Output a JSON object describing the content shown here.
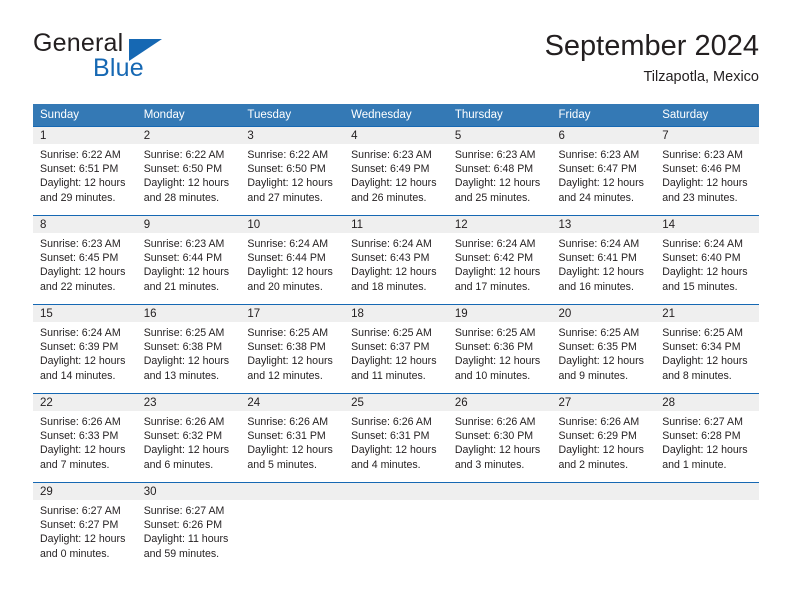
{
  "brand": {
    "name_top": "General",
    "name_bottom": "Blue",
    "triangle_icon": "triangle-icon",
    "color_dark": "#231f20",
    "color_blue": "#1668b3"
  },
  "header": {
    "title": "September 2024",
    "subtitle": "Tilzapotla, Mexico"
  },
  "theme": {
    "header_bg": "#3479b5",
    "header_text": "#ffffff",
    "row_divider": "#1668b3",
    "daynum_band": "#efefef",
    "body_text": "#231f20"
  },
  "weekday_headers": [
    "Sunday",
    "Monday",
    "Tuesday",
    "Wednesday",
    "Thursday",
    "Friday",
    "Saturday"
  ],
  "weeks": [
    [
      {
        "day": "1",
        "sunrise": "Sunrise: 6:22 AM",
        "sunset": "Sunset: 6:51 PM",
        "daylight1": "Daylight: 12 hours",
        "daylight2": "and 29 minutes."
      },
      {
        "day": "2",
        "sunrise": "Sunrise: 6:22 AM",
        "sunset": "Sunset: 6:50 PM",
        "daylight1": "Daylight: 12 hours",
        "daylight2": "and 28 minutes."
      },
      {
        "day": "3",
        "sunrise": "Sunrise: 6:22 AM",
        "sunset": "Sunset: 6:50 PM",
        "daylight1": "Daylight: 12 hours",
        "daylight2": "and 27 minutes."
      },
      {
        "day": "4",
        "sunrise": "Sunrise: 6:23 AM",
        "sunset": "Sunset: 6:49 PM",
        "daylight1": "Daylight: 12 hours",
        "daylight2": "and 26 minutes."
      },
      {
        "day": "5",
        "sunrise": "Sunrise: 6:23 AM",
        "sunset": "Sunset: 6:48 PM",
        "daylight1": "Daylight: 12 hours",
        "daylight2": "and 25 minutes."
      },
      {
        "day": "6",
        "sunrise": "Sunrise: 6:23 AM",
        "sunset": "Sunset: 6:47 PM",
        "daylight1": "Daylight: 12 hours",
        "daylight2": "and 24 minutes."
      },
      {
        "day": "7",
        "sunrise": "Sunrise: 6:23 AM",
        "sunset": "Sunset: 6:46 PM",
        "daylight1": "Daylight: 12 hours",
        "daylight2": "and 23 minutes."
      }
    ],
    [
      {
        "day": "8",
        "sunrise": "Sunrise: 6:23 AM",
        "sunset": "Sunset: 6:45 PM",
        "daylight1": "Daylight: 12 hours",
        "daylight2": "and 22 minutes."
      },
      {
        "day": "9",
        "sunrise": "Sunrise: 6:23 AM",
        "sunset": "Sunset: 6:44 PM",
        "daylight1": "Daylight: 12 hours",
        "daylight2": "and 21 minutes."
      },
      {
        "day": "10",
        "sunrise": "Sunrise: 6:24 AM",
        "sunset": "Sunset: 6:44 PM",
        "daylight1": "Daylight: 12 hours",
        "daylight2": "and 20 minutes."
      },
      {
        "day": "11",
        "sunrise": "Sunrise: 6:24 AM",
        "sunset": "Sunset: 6:43 PM",
        "daylight1": "Daylight: 12 hours",
        "daylight2": "and 18 minutes."
      },
      {
        "day": "12",
        "sunrise": "Sunrise: 6:24 AM",
        "sunset": "Sunset: 6:42 PM",
        "daylight1": "Daylight: 12 hours",
        "daylight2": "and 17 minutes."
      },
      {
        "day": "13",
        "sunrise": "Sunrise: 6:24 AM",
        "sunset": "Sunset: 6:41 PM",
        "daylight1": "Daylight: 12 hours",
        "daylight2": "and 16 minutes."
      },
      {
        "day": "14",
        "sunrise": "Sunrise: 6:24 AM",
        "sunset": "Sunset: 6:40 PM",
        "daylight1": "Daylight: 12 hours",
        "daylight2": "and 15 minutes."
      }
    ],
    [
      {
        "day": "15",
        "sunrise": "Sunrise: 6:24 AM",
        "sunset": "Sunset: 6:39 PM",
        "daylight1": "Daylight: 12 hours",
        "daylight2": "and 14 minutes."
      },
      {
        "day": "16",
        "sunrise": "Sunrise: 6:25 AM",
        "sunset": "Sunset: 6:38 PM",
        "daylight1": "Daylight: 12 hours",
        "daylight2": "and 13 minutes."
      },
      {
        "day": "17",
        "sunrise": "Sunrise: 6:25 AM",
        "sunset": "Sunset: 6:38 PM",
        "daylight1": "Daylight: 12 hours",
        "daylight2": "and 12 minutes."
      },
      {
        "day": "18",
        "sunrise": "Sunrise: 6:25 AM",
        "sunset": "Sunset: 6:37 PM",
        "daylight1": "Daylight: 12 hours",
        "daylight2": "and 11 minutes."
      },
      {
        "day": "19",
        "sunrise": "Sunrise: 6:25 AM",
        "sunset": "Sunset: 6:36 PM",
        "daylight1": "Daylight: 12 hours",
        "daylight2": "and 10 minutes."
      },
      {
        "day": "20",
        "sunrise": "Sunrise: 6:25 AM",
        "sunset": "Sunset: 6:35 PM",
        "daylight1": "Daylight: 12 hours",
        "daylight2": "and 9 minutes."
      },
      {
        "day": "21",
        "sunrise": "Sunrise: 6:25 AM",
        "sunset": "Sunset: 6:34 PM",
        "daylight1": "Daylight: 12 hours",
        "daylight2": "and 8 minutes."
      }
    ],
    [
      {
        "day": "22",
        "sunrise": "Sunrise: 6:26 AM",
        "sunset": "Sunset: 6:33 PM",
        "daylight1": "Daylight: 12 hours",
        "daylight2": "and 7 minutes."
      },
      {
        "day": "23",
        "sunrise": "Sunrise: 6:26 AM",
        "sunset": "Sunset: 6:32 PM",
        "daylight1": "Daylight: 12 hours",
        "daylight2": "and 6 minutes."
      },
      {
        "day": "24",
        "sunrise": "Sunrise: 6:26 AM",
        "sunset": "Sunset: 6:31 PM",
        "daylight1": "Daylight: 12 hours",
        "daylight2": "and 5 minutes."
      },
      {
        "day": "25",
        "sunrise": "Sunrise: 6:26 AM",
        "sunset": "Sunset: 6:31 PM",
        "daylight1": "Daylight: 12 hours",
        "daylight2": "and 4 minutes."
      },
      {
        "day": "26",
        "sunrise": "Sunrise: 6:26 AM",
        "sunset": "Sunset: 6:30 PM",
        "daylight1": "Daylight: 12 hours",
        "daylight2": "and 3 minutes."
      },
      {
        "day": "27",
        "sunrise": "Sunrise: 6:26 AM",
        "sunset": "Sunset: 6:29 PM",
        "daylight1": "Daylight: 12 hours",
        "daylight2": "and 2 minutes."
      },
      {
        "day": "28",
        "sunrise": "Sunrise: 6:27 AM",
        "sunset": "Sunset: 6:28 PM",
        "daylight1": "Daylight: 12 hours",
        "daylight2": "and 1 minute."
      }
    ],
    [
      {
        "day": "29",
        "sunrise": "Sunrise: 6:27 AM",
        "sunset": "Sunset: 6:27 PM",
        "daylight1": "Daylight: 12 hours",
        "daylight2": "and 0 minutes."
      },
      {
        "day": "30",
        "sunrise": "Sunrise: 6:27 AM",
        "sunset": "Sunset: 6:26 PM",
        "daylight1": "Daylight: 11 hours",
        "daylight2": "and 59 minutes."
      },
      {
        "day": "",
        "sunrise": "",
        "sunset": "",
        "daylight1": "",
        "daylight2": ""
      },
      {
        "day": "",
        "sunrise": "",
        "sunset": "",
        "daylight1": "",
        "daylight2": ""
      },
      {
        "day": "",
        "sunrise": "",
        "sunset": "",
        "daylight1": "",
        "daylight2": ""
      },
      {
        "day": "",
        "sunrise": "",
        "sunset": "",
        "daylight1": "",
        "daylight2": ""
      },
      {
        "day": "",
        "sunrise": "",
        "sunset": "",
        "daylight1": "",
        "daylight2": ""
      }
    ]
  ]
}
